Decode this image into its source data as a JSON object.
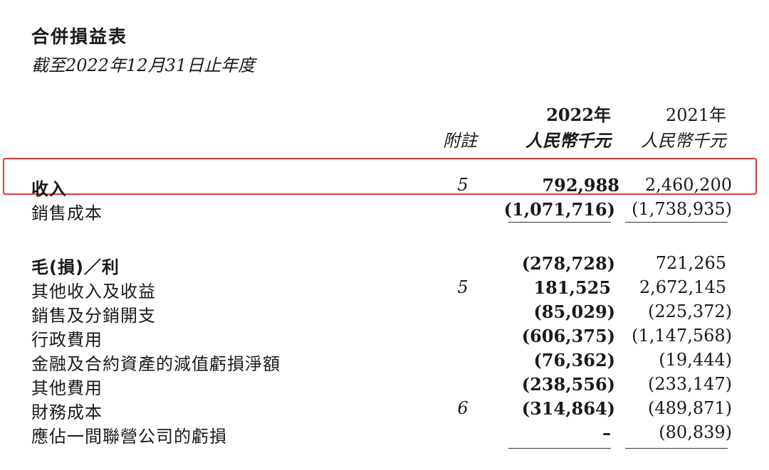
{
  "header": {
    "title": "合併損益表",
    "subtitle": "截至2022年12月31日止年度"
  },
  "columns": {
    "note_label": "附註",
    "y2022_year": "2022年",
    "y2022_unit": "人民幣千元",
    "y2021_year": "2021年",
    "y2021_unit": "人民幣千元"
  },
  "rows": [
    {
      "label": "收入",
      "note": "5",
      "v2022": "792,988",
      "v2021": "2,460,200"
    },
    {
      "label": "銷售成本",
      "note": "",
      "v2022": "(1,071,716)",
      "v2021": "(1,738,935)"
    },
    {
      "label": "毛(損)／利",
      "note": "",
      "v2022": "(278,728)",
      "v2021": "721,265"
    },
    {
      "label": "其他收入及收益",
      "note": "5",
      "v2022": "181,525",
      "v2021": "2,672,145"
    },
    {
      "label": "銷售及分銷開支",
      "note": "",
      "v2022": "(85,029)",
      "v2021": "(225,372)"
    },
    {
      "label": "行政費用",
      "note": "",
      "v2022": "(606,375)",
      "v2021": "(1,147,568)"
    },
    {
      "label": "金融及合約資產的減值虧損淨額",
      "note": "",
      "v2022": "(76,362)",
      "v2021": "(19,444)"
    },
    {
      "label": "其他費用",
      "note": "",
      "v2022": "(238,556)",
      "v2021": "(233,147)"
    },
    {
      "label": "財務成本",
      "note": "6",
      "v2022": "(314,864)",
      "v2021": "(489,871)"
    },
    {
      "label": "應佔一間聯營公司的虧損",
      "note": "",
      "v2022": "–",
      "v2021": "(80,839)"
    }
  ]
}
